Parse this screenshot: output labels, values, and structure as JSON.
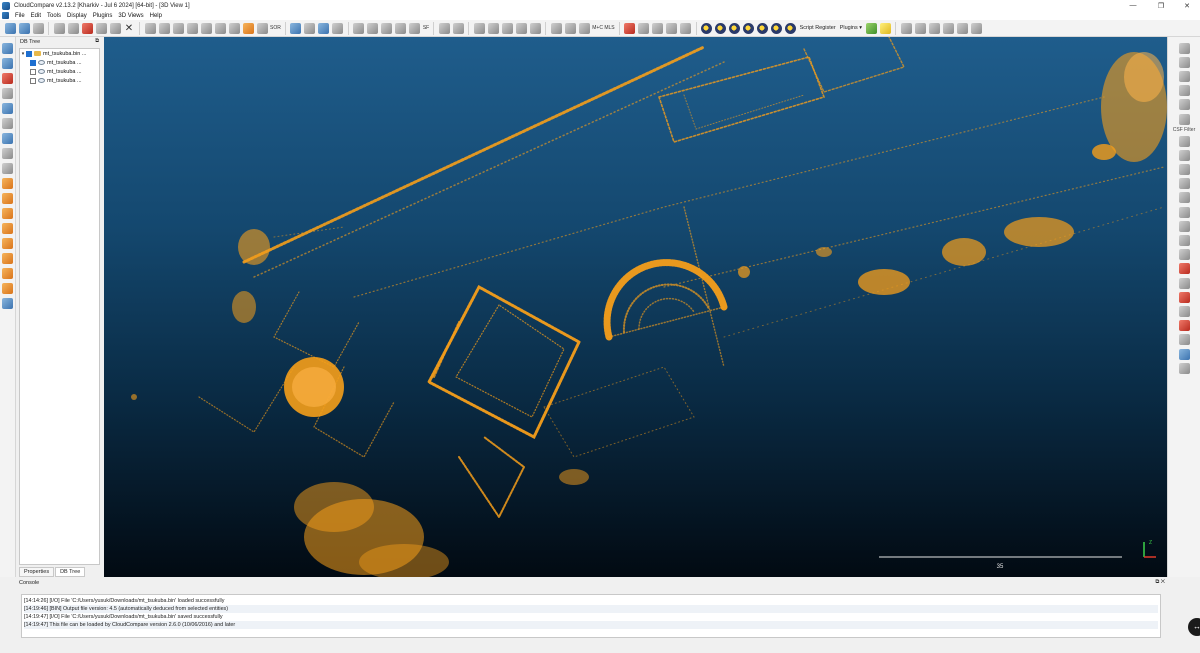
{
  "window": {
    "title": "CloudCompare v2.13.2 [Kharkiv - Jul  6 2024] [64-bit] - [3D View 1]",
    "minimize": "—",
    "maximize": "❐",
    "close": "✕"
  },
  "menu": [
    "File",
    "Edit",
    "Tools",
    "Display",
    "Plugins",
    "3D Views",
    "Help"
  ],
  "toolbar": {
    "sor_label": "SOR",
    "sf_label": "SF",
    "mls_label": "M+C MLS",
    "script_register": "Script Register",
    "plugins": "Plugins",
    "dropdown": "▾"
  },
  "db_tree": {
    "header": "DB Tree",
    "float_btn": "⧉",
    "root": "mt_tsukuba.bin ...",
    "children": [
      "mt_tsukuba ...",
      "mt_tsukuba ...",
      "mt_tsukuba ..."
    ],
    "tabs": [
      "Properties",
      "DB Tree"
    ]
  },
  "right_toolbar": {
    "csf_label": "CSF Filter"
  },
  "view3d": {
    "scale_label": "35",
    "axis_z": "Z",
    "colors": {
      "points": "#f59e1a",
      "bg_top": "#1f5d8c",
      "bg_bottom": "#020a12"
    }
  },
  "console": {
    "header": "Console",
    "buttons": "⧉ ✕",
    "lines": [
      "[14:14:26] [I/O] File 'C:/Users/yusuk/Downloads/mt_tsukuba.bin' loaded successfully",
      "[14:19:46] [BIN] Output file version: 4.5 (automatically deduced from selected entities)",
      "[14:19:47] [I/O] File 'C:/Users/yusuk/Downloads/mt_tsukuba.bin' saved successfully",
      "[14:19:47] This file can be loaded by CloudCompare version 2.6.0 (10/06/2016) and later"
    ]
  },
  "floating_button": "↔"
}
